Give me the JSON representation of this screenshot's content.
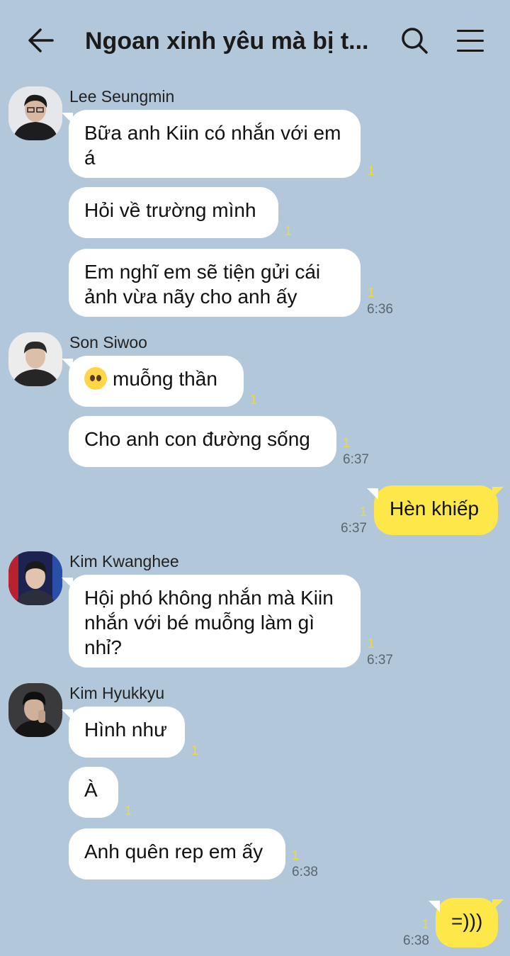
{
  "header": {
    "title": "Ngoan xinh yêu mà bị t..."
  },
  "senders": {
    "lee": "Lee Seungmin",
    "son": "Son Siwoo",
    "kimkw": "Kim Kwanghee",
    "kimhk": "Kim Hyukkyu"
  },
  "messages": [
    {
      "text": "Bữa anh Kiin có nhắn với em á",
      "unread": "1"
    },
    {
      "text": "Hỏi về trường mình",
      "unread": "1"
    },
    {
      "text": "Em nghĩ em sẽ tiện gửi cái ảnh vừa nãy cho anh ấy",
      "unread": "1",
      "time": "6:36"
    },
    {
      "text": "muỗng thần",
      "unread": "1"
    },
    {
      "text": "Cho anh con đường sống",
      "unread": "1",
      "time": "6:37"
    },
    {
      "text": "Hèn khiếp",
      "unread": "1",
      "time": "6:37"
    },
    {
      "text": "Hội phó không nhắn mà Kiin nhắn với bé muỗng làm gì nhỉ?",
      "unread": "1",
      "time": "6:37"
    },
    {
      "text": "Hình như",
      "unread": "1"
    },
    {
      "text": "À",
      "unread": "1"
    },
    {
      "text": "Anh quên rep em ấy",
      "unread": "1",
      "time": "6:38"
    },
    {
      "text": "=)))",
      "unread": "1",
      "time": "6:38"
    }
  ],
  "colors": {
    "background": "#b2c7da",
    "my_bubble": "#fee749",
    "their_bubble": "#ffffff",
    "unread": "#f0d935"
  },
  "icons": [
    "back-arrow-icon",
    "search-icon",
    "menu-icon",
    "pleading-face-emoji"
  ]
}
